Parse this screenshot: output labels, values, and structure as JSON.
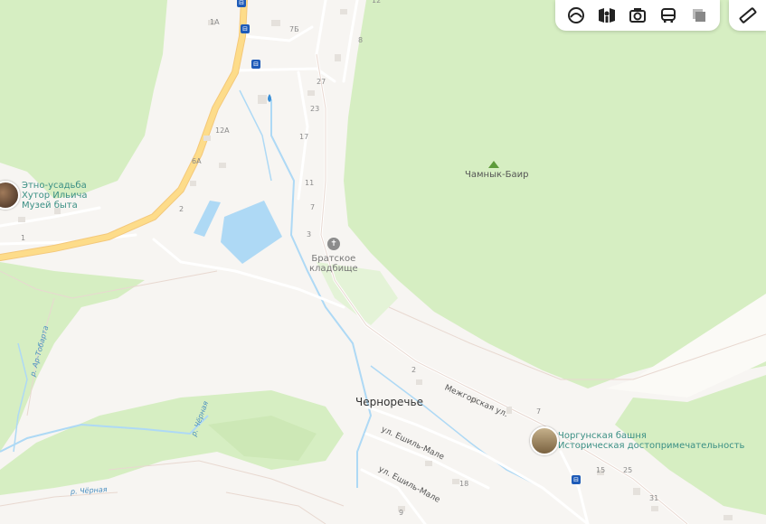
{
  "places": {
    "chernorechye": "Черноречье",
    "chamnyk_bair": "Чамнык-Баир"
  },
  "pois": {
    "hutor": [
      "Этно-усадьба",
      "Хутор Ильича",
      "Музей быта"
    ],
    "cemetery": [
      "Братское",
      "кладбище"
    ],
    "tower": [
      "Чоргунская башня",
      "Историческая достопримечательность"
    ]
  },
  "streets": {
    "mezhgorskaya": "Межгорская ул.",
    "eshil_male_1": "ул. Ешиль-Мале",
    "eshil_male_2": "ул. Ешиль-Мале"
  },
  "rivers": {
    "ar_tobarta": "р. Ар-Тобарта",
    "chyornaya_1": "р. Чёрная",
    "chyornaya_2": "р. Чёрная"
  },
  "house_numbers": {
    "n12": "12",
    "n1a": "1A",
    "n7b": "7Б",
    "n8": "8",
    "n27": "27",
    "n23": "23",
    "n12a": "12A",
    "n17": "17",
    "n6a": "6A",
    "n11": "11",
    "n2a": "2",
    "n7a": "7",
    "n3": "3",
    "n1": "1",
    "n2b": "2",
    "n7c": "7",
    "n15": "15",
    "n25": "25",
    "n18": "18",
    "n31": "31",
    "n9": "9"
  },
  "toolbar": {
    "buttons": [
      "layers-icon",
      "panorama-icon",
      "photo-icon",
      "transport-icon",
      "map-type-icon"
    ],
    "ruler": "ruler-icon"
  },
  "colors": {
    "forest": "#d6eec2",
    "forest_light": "#e4f3d7",
    "land": "#f7f5f2",
    "water": "#aed9f5",
    "highway": "#fddc8a",
    "poi_text": "#3a8f84",
    "transit": "#1e5bb8"
  }
}
